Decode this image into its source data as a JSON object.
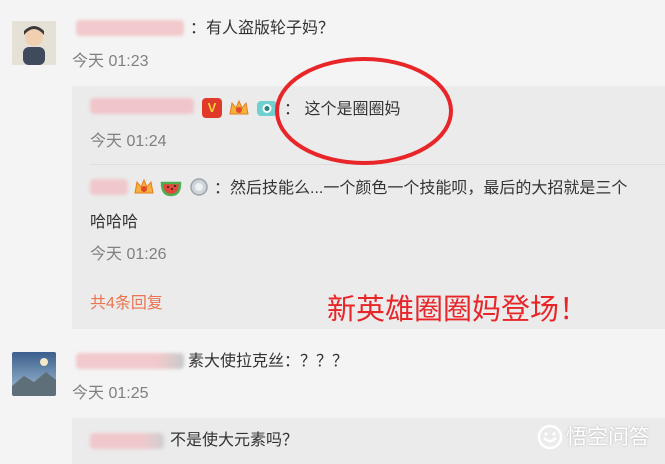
{
  "comments": [
    {
      "text": "：有人盗版轮子妈？",
      "time": "今天 01:23",
      "replies": [
        {
          "text": "：  这个是圈圈妈",
          "time": "今天 01:24"
        },
        {
          "text": "：然后技能么...一个颜色一个技能呗，最后的大招就是三个",
          "text2": "哈哈哈",
          "time": "今天 01:26"
        }
      ],
      "more_link": "共4条回复"
    },
    {
      "text": "素大使拉克丝：？？？",
      "time": "今天 01:25",
      "replies": [
        {
          "text": "不是使大元素吗？"
        }
      ]
    }
  ],
  "annotation": "新英雄圈圈妈登场！",
  "watermark": "悟空问答",
  "colors": {
    "accent_red": "#e8262a",
    "link_orange": "#eb7350",
    "time_gray": "#808080",
    "reply_bg": "#ebebeb"
  },
  "icons": [
    "v-badge-icon",
    "crown-icon",
    "camera-icon",
    "watermelon-icon",
    "medal-icon",
    "wukong-logo-icon"
  ]
}
